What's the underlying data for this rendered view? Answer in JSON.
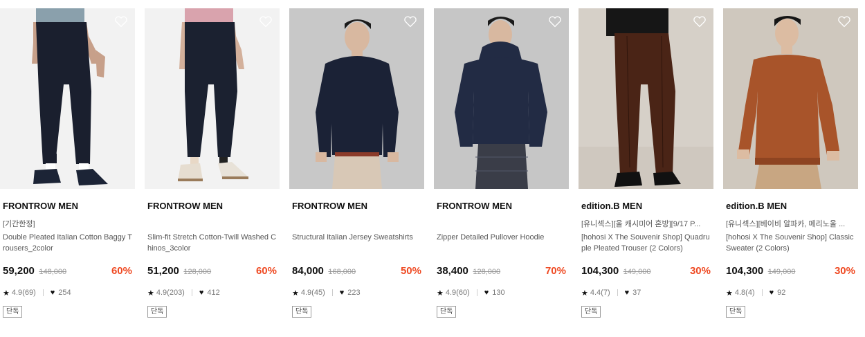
{
  "products": [
    {
      "brand": "FRONTROW MEN",
      "tagline": "[기간한정]",
      "name": "Double Pleated Italian Cotton Baggy Trousers_2color",
      "price": "59,200",
      "original_price": "148,000",
      "discount": "60%",
      "rating": "4.9(69)",
      "likes": "254",
      "badge": "단독",
      "image": "model-navy-trousers"
    },
    {
      "brand": "FRONTROW MEN",
      "tagline": "",
      "name": "Slim-fit Stretch Cotton-Twill Washed Chinos_3color",
      "price": "51,200",
      "original_price": "128,000",
      "discount": "60%",
      "rating": "4.9(203)",
      "likes": "412",
      "badge": "단독",
      "image": "model-navy-chinos"
    },
    {
      "brand": "FRONTROW MEN",
      "tagline": "",
      "name": "Structural Italian Jersey Sweatshirts",
      "price": "84,000",
      "original_price": "168,000",
      "discount": "50%",
      "rating": "4.9(45)",
      "likes": "223",
      "badge": "단독",
      "image": "model-navy-sweatshirt"
    },
    {
      "brand": "FRONTROW MEN",
      "tagline": "",
      "name": "Zipper Detailed Pullover Hoodie",
      "price": "38,400",
      "original_price": "128,000",
      "discount": "70%",
      "rating": "4.9(60)",
      "likes": "130",
      "badge": "단독",
      "image": "model-navy-hoodie"
    },
    {
      "brand": "edition.B MEN",
      "tagline": "[유니섹스][울 캐시미어 혼방][9/17 P...",
      "name": "[hohosi X The Souvenir Shop] Quadruple Pleated Trouser (2 Colors)",
      "price": "104,300",
      "original_price": "149,000",
      "discount": "30%",
      "rating": "4.4(7)",
      "likes": "37",
      "badge": "단독",
      "image": "model-brown-trousers"
    },
    {
      "brand": "edition.B MEN",
      "tagline": "[유니섹스][베이비 알파카, 메리노울 ...",
      "name": "[hohosi X The Souvenir Shop] Classic Sweater (2 Colors)",
      "price": "104,300",
      "original_price": "149,000",
      "discount": "30%",
      "rating": "4.8(4)",
      "likes": "92",
      "badge": "단독",
      "image": "model-orange-sweater"
    }
  ],
  "colors": {
    "discount": "#ef4a23",
    "navy": "#1c2233",
    "brown": "#4a2a1a",
    "rust": "#b05a2e",
    "photo_bg": "#eeeeee",
    "photo_bg_grey": "#c9c9c9"
  },
  "icons": {
    "wishlist": "heart-outline-icon",
    "rating": "star-icon",
    "likes": "heart-filled-icon"
  }
}
